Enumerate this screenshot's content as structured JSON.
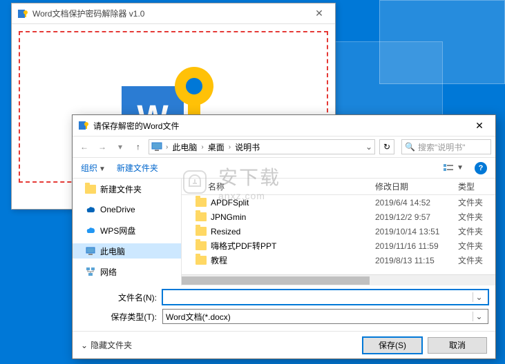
{
  "app": {
    "title": "Word文档保护密码解除器 v1.0"
  },
  "dialog": {
    "title": "请保存解密的Word文件",
    "breadcrumb": {
      "pc": "此电脑",
      "desktop": "桌面",
      "folder": "说明书"
    },
    "search_placeholder": "搜索\"说明书\"",
    "toolbar": {
      "organize": "组织",
      "new_folder": "新建文件夹"
    },
    "tree": {
      "new_folder": "新建文件夹",
      "onedrive": "OneDrive",
      "wps": "WPS网盘",
      "this_pc": "此电脑",
      "network": "网络"
    },
    "columns": {
      "name": "名称",
      "date": "修改日期",
      "type": "类型"
    },
    "files": [
      {
        "name": "APDFSplit",
        "date": "2019/6/4 14:52",
        "type": "文件夹"
      },
      {
        "name": "JPNGmin",
        "date": "2019/12/2 9:57",
        "type": "文件夹"
      },
      {
        "name": "Resized",
        "date": "2019/10/14 13:51",
        "type": "文件夹"
      },
      {
        "name": "嗨格式PDF转PPT",
        "date": "2019/11/16 11:59",
        "type": "文件夹"
      },
      {
        "name": "教程",
        "date": "2019/8/13 11:15",
        "type": "文件夹"
      }
    ],
    "labels": {
      "filename": "文件名(N):",
      "filetype": "保存类型(T):"
    },
    "filetype_value": "Word文档(*.docx)",
    "hide_folders": "隐藏文件夹",
    "save": "保存(S)",
    "cancel": "取消"
  },
  "watermark": {
    "main": "安下载",
    "sub": "anxz.com"
  }
}
